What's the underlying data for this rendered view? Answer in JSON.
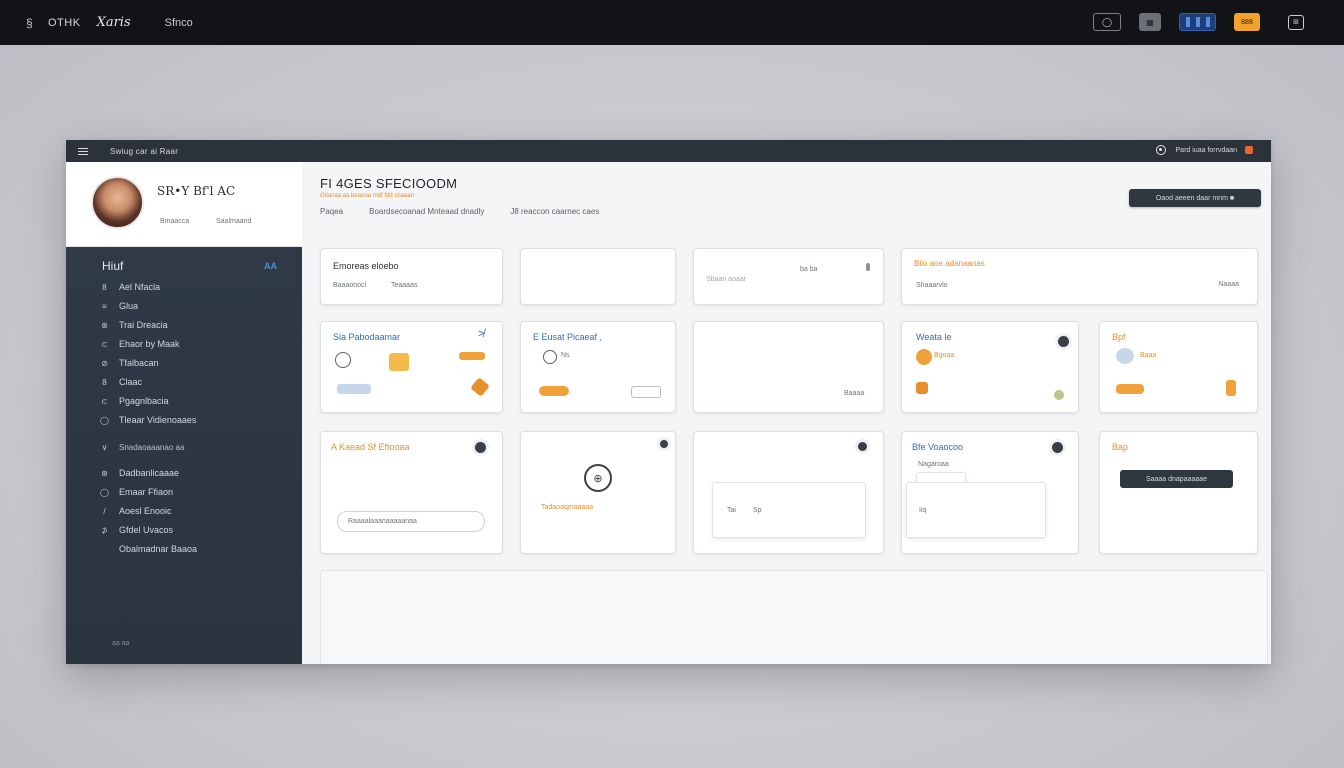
{
  "os_bar": {
    "brand": "OTHK",
    "brand_script": "Xaris",
    "menu": "Sfnco",
    "btn_outline": "◯",
    "btn_gray": "▦",
    "btn_orange": "888",
    "btn_square": "⊞"
  },
  "app_bar": {
    "title": "Swiug car ai Raar",
    "right_link": "Pard iuaa forrvdaan"
  },
  "profile": {
    "name": "SR•Y Bf'l AC",
    "meta_left": "Bmaacca",
    "meta_right": "Saalmaand"
  },
  "sidebar": {
    "heading": "Hiuf",
    "heading_badge": "AA",
    "items": [
      {
        "icon": "8",
        "label": "Ael Nfacla"
      },
      {
        "icon": "≡",
        "label": "Glua"
      },
      {
        "icon": "⊛",
        "label": "Trai Dreacia"
      },
      {
        "icon": "⊂",
        "label": "Ehaor by Maak"
      },
      {
        "icon": "⊘",
        "label": "Tfalbacan"
      },
      {
        "icon": "8",
        "label": "Claac"
      },
      {
        "icon": "⊂",
        "label": "Pgagnlbacia"
      },
      {
        "icon": "◯",
        "label": "Tleaar Vidienoaaes"
      }
    ],
    "group_label": "Snadaoaaanao aa",
    "group_items": [
      {
        "icon": "⊛",
        "label": "Dadbanlicaaae"
      },
      {
        "icon": "◯",
        "label": "Emaar Ffiaon"
      },
      {
        "icon": "/",
        "label": "Aoesl Enooic"
      },
      {
        "icon": "⊅",
        "label": "Gfdel Uvacos"
      },
      {
        "icon": "",
        "label": "Obalmadnar Baaoa"
      }
    ],
    "footer": "aa aa"
  },
  "main": {
    "title": "FI 4GES SFECIOODM",
    "subtitle": "Gtlanaa aa beauoa mdf fdd sbaaan",
    "filters": [
      "Paqea",
      "Boardsecoanad Mnteaad dnadly",
      "J8 reaccon caarnec caes"
    ],
    "top_action": "Oaod aeeen daar mnm ■"
  },
  "cards": {
    "r1c1": {
      "title": "Emoreas eloebo",
      "sub_a": "Baaaonocl",
      "sub_b": "Teaaaas"
    },
    "r1c3": {
      "sub": "Sbaan aoaar",
      "tag": "ba ba"
    },
    "r1c4": {
      "title": "Bilo aoe adanaanas",
      "sub": "Shaaarvlo",
      "tag": "Naaaa"
    },
    "r2c1": {
      "title": "Sia Pabodaamar",
      "glyph": "≯"
    },
    "r2c2": {
      "title": "E Eusat Picaeaf ,",
      "sub": "Ns"
    },
    "r2c3": {
      "tag": "Baaaa"
    },
    "r2c4": {
      "title": "Weata le",
      "sub": "Bgoaa"
    },
    "r2c5": {
      "title": "Bpf",
      "sub": "Baaa"
    },
    "r3c1": {
      "title": "A Kaead Sf Eftooaa",
      "input": "Raaaalaaanaaaaanaa"
    },
    "r3c2": {
      "sub": "Tadaoaqmaaaaa",
      "icon": "⊕"
    },
    "r3c3": {
      "sheet_a": "Tai",
      "sheet_b": "Sp"
    },
    "r3c4": {
      "title": "Bfe Voaocoo",
      "sub": "Nagaroaa",
      "sheet_label": "Iiq"
    },
    "r3c5": {
      "title": "Bap",
      "pill": "Saaaa dnapaaaaae"
    }
  },
  "colors": {
    "accent_orange": "#e8902c",
    "accent_blue": "#2e6fb8",
    "sidebar_bg": "#2f3a46",
    "os_bar_bg": "#121316"
  }
}
